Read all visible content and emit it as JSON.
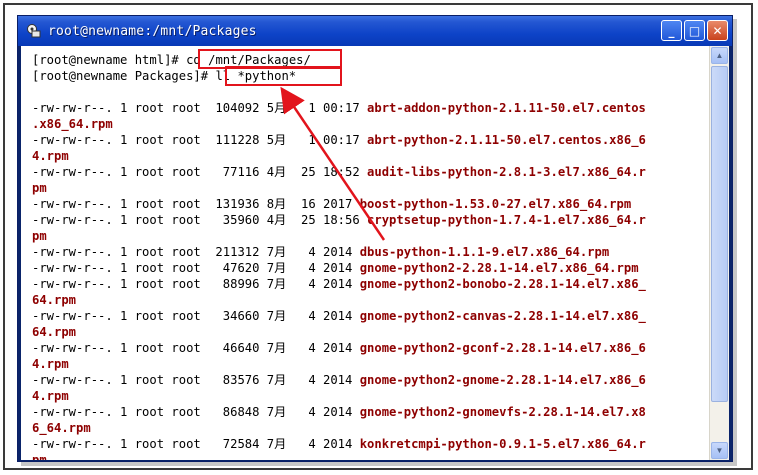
{
  "window": {
    "title": "root@newname:/mnt/Packages",
    "controls": {
      "minimize": "_",
      "maximize": "□",
      "close": "✕"
    }
  },
  "terminal": {
    "commands": [
      {
        "prompt": "[root@newname html]# ",
        "cmd": "cd /mnt/Packages/"
      },
      {
        "prompt": "[root@newname Packages]# ",
        "cmd": "ll *python*"
      }
    ],
    "rows": [
      {
        "meta": "-rw-rw-r--. 1 root root  104092 5月   1 00:17 ",
        "name": "abrt-addon-python-2.1.11-50.el7.centos"
      },
      {
        "meta": "",
        "name": ".x86_64.rpm"
      },
      {
        "meta": "-rw-rw-r--. 1 root root  111228 5月   1 00:17 ",
        "name": "abrt-python-2.1.11-50.el7.centos.x86_6"
      },
      {
        "meta": "",
        "name": "4.rpm"
      },
      {
        "meta": "-rw-rw-r--. 1 root root   77116 4月  25 18:52 ",
        "name": "audit-libs-python-2.8.1-3.el7.x86_64.r"
      },
      {
        "meta": "",
        "name": "pm"
      },
      {
        "meta": "-rw-rw-r--. 1 root root  131936 8月  16 2017 ",
        "name": "boost-python-1.53.0-27.el7.x86_64.rpm"
      },
      {
        "meta": "-rw-rw-r--. 1 root root   35960 4月  25 18:56 ",
        "name": "cryptsetup-python-1.7.4-1.el7.x86_64.r"
      },
      {
        "meta": "",
        "name": "pm"
      },
      {
        "meta": "-rw-rw-r--. 1 root root  211312 7月   4 2014 ",
        "name": "dbus-python-1.1.1-9.el7.x86_64.rpm"
      },
      {
        "meta": "-rw-rw-r--. 1 root root   47620 7月   4 2014 ",
        "name": "gnome-python2-2.28.1-14.el7.x86_64.rpm"
      },
      {
        "meta": "-rw-rw-r--. 1 root root   88996 7月   4 2014 ",
        "name": "gnome-python2-bonobo-2.28.1-14.el7.x86_"
      },
      {
        "meta": "",
        "name": "64.rpm"
      },
      {
        "meta": "-rw-rw-r--. 1 root root   34660 7月   4 2014 ",
        "name": "gnome-python2-canvas-2.28.1-14.el7.x86_"
      },
      {
        "meta": "",
        "name": "64.rpm"
      },
      {
        "meta": "-rw-rw-r--. 1 root root   46640 7月   4 2014 ",
        "name": "gnome-python2-gconf-2.28.1-14.el7.x86_6"
      },
      {
        "meta": "",
        "name": "4.rpm"
      },
      {
        "meta": "-rw-rw-r--. 1 root root   83576 7月   4 2014 ",
        "name": "gnome-python2-gnome-2.28.1-14.el7.x86_6"
      },
      {
        "meta": "",
        "name": "4.rpm"
      },
      {
        "meta": "-rw-rw-r--. 1 root root   86848 7月   4 2014 ",
        "name": "gnome-python2-gnomevfs-2.28.1-14.el7.x8"
      },
      {
        "meta": "",
        "name": "6_64.rpm"
      },
      {
        "meta": "-rw-rw-r--. 1 root root   72584 7月   4 2014 ",
        "name": "konkretcmpi-python-0.9.1-5.el7.x86_64.r"
      },
      {
        "meta": "",
        "name": "pm"
      }
    ]
  },
  "icons": {
    "app": "terminal-icon"
  },
  "colors": {
    "filename": "#8e0000",
    "highlight": "#e2141c",
    "titlebar": "#0d43c8"
  }
}
